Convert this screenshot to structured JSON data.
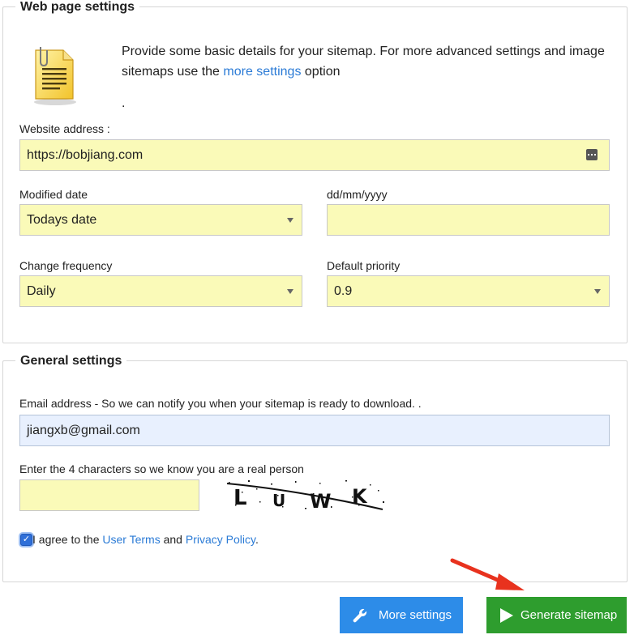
{
  "web_page_settings": {
    "legend": "Web page settings",
    "intro_text_before": "Provide some basic details for your sitemap. For more advanced settings and image sitemaps use the",
    "intro_link": "more settings",
    "intro_text_after": "option",
    "intro_dot": ".",
    "icon": "document-clip-icon",
    "website_address": {
      "label": "Website address :",
      "value": "https://bobjiang.com"
    },
    "modified_date": {
      "label": "Modified date",
      "value": "Todays date"
    },
    "date_field": {
      "label": "dd/mm/yyyy",
      "value": ""
    },
    "change_frequency": {
      "label": "Change frequency",
      "value": "Daily"
    },
    "default_priority": {
      "label": "Default priority",
      "value": "0.9"
    }
  },
  "general_settings": {
    "legend": "General settings",
    "email": {
      "label": "Email address - So we can notify you when your sitemap is ready to download. .",
      "value": "jiangxb@gmail.com"
    },
    "captcha": {
      "label": "Enter the 4 characters so we know you are a real person",
      "value": "",
      "characters": [
        "L",
        "U",
        "W",
        "K"
      ]
    },
    "agree": {
      "checked": true,
      "text_before": "I agree to the",
      "terms_link": "User Terms",
      "text_mid": "and",
      "privacy_link": "Privacy Policy",
      "text_after": "."
    }
  },
  "buttons": {
    "more_settings": {
      "label": "More settings",
      "icon": "wrench-icon",
      "color": "#2d8ce8"
    },
    "generate_sitemap": {
      "label": "Generate sitemap",
      "icon": "play-icon",
      "color": "#2e9d2e"
    }
  },
  "annotation": {
    "icon": "red-arrow-icon",
    "color": "#e8321e"
  }
}
